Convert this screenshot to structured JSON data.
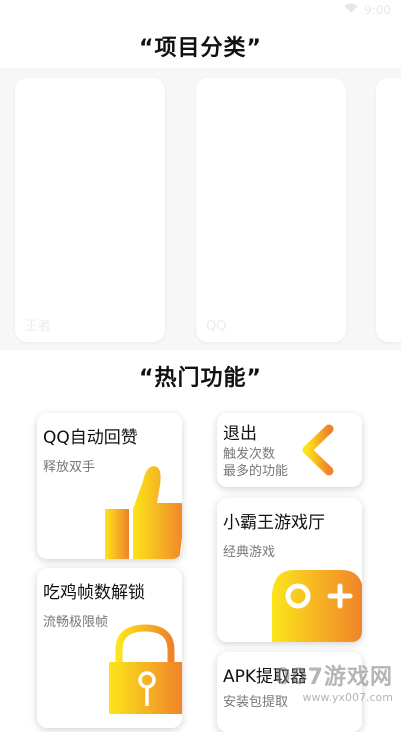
{
  "status_bar": {
    "time": "9:00"
  },
  "categories": {
    "title": "“项目分类”",
    "items": [
      {
        "label": "王者"
      },
      {
        "label": "QQ"
      }
    ]
  },
  "features": {
    "title": "“热门功能”",
    "cards": [
      {
        "title": "QQ自动回赞",
        "subtitle": "释放双手"
      },
      {
        "title": "退出",
        "subtitle_line1": "触发次数",
        "subtitle_line2": "最多的功能"
      },
      {
        "title": "小霸王游戏厅",
        "subtitle": "经典游戏"
      },
      {
        "title": "吃鸡帧数解锁",
        "subtitle": "流畅极限帧"
      },
      {
        "title": "APK提取器",
        "subtitle": "安装包提取"
      }
    ]
  },
  "watermark": {
    "main": "007游戏网",
    "url": "www.yx007.com"
  },
  "colors": {
    "accent_start": "#fce51a",
    "accent_end": "#f0822a"
  }
}
